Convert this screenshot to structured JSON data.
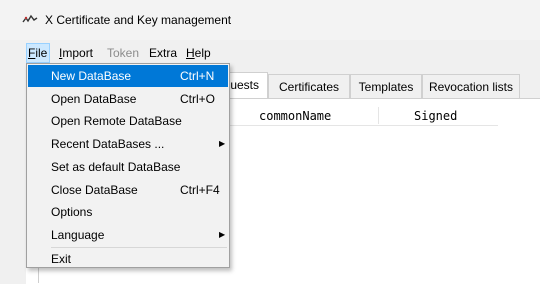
{
  "window": {
    "title": "X Certificate and Key management",
    "icon": "xca-app-icon"
  },
  "menubar": {
    "items": [
      {
        "label": "File",
        "mnemonic": "F",
        "rest": "ile",
        "state": "active"
      },
      {
        "label": "Import",
        "mnemonic": "I",
        "rest": "mport",
        "state": "normal"
      },
      {
        "label": "Token",
        "state": "disabled"
      },
      {
        "label": "Extra",
        "state": "normal"
      },
      {
        "label": "Help",
        "mnemonic": "H",
        "rest": "elp",
        "state": "normal"
      }
    ]
  },
  "tabs": [
    {
      "label": "quests",
      "selected": true
    },
    {
      "label": "Certificates",
      "selected": false
    },
    {
      "label": "Templates",
      "selected": false
    },
    {
      "label": "Revocation lists",
      "selected": false
    }
  ],
  "table": {
    "columns": [
      "commonName",
      "Signed"
    ]
  },
  "file_menu": {
    "items": [
      {
        "label": "New DataBase",
        "shortcut": "Ctrl+N",
        "highlighted": true
      },
      {
        "label": "Open DataBase",
        "shortcut": "Ctrl+O"
      },
      {
        "label": "Open Remote DataBase",
        "shortcut": ""
      },
      {
        "label": "Recent DataBases ...",
        "shortcut": "",
        "submenu": true
      },
      {
        "label": "Set as default DataBase",
        "shortcut": ""
      },
      {
        "label": "Close DataBase",
        "shortcut": "Ctrl+F4"
      },
      {
        "label": "Options",
        "shortcut": ""
      },
      {
        "label": "Language",
        "shortcut": "",
        "submenu": true
      },
      {
        "label": "Exit",
        "shortcut": ""
      }
    ]
  },
  "colors": {
    "highlight": "#0078d7",
    "menu_active": "#cce8ff"
  }
}
